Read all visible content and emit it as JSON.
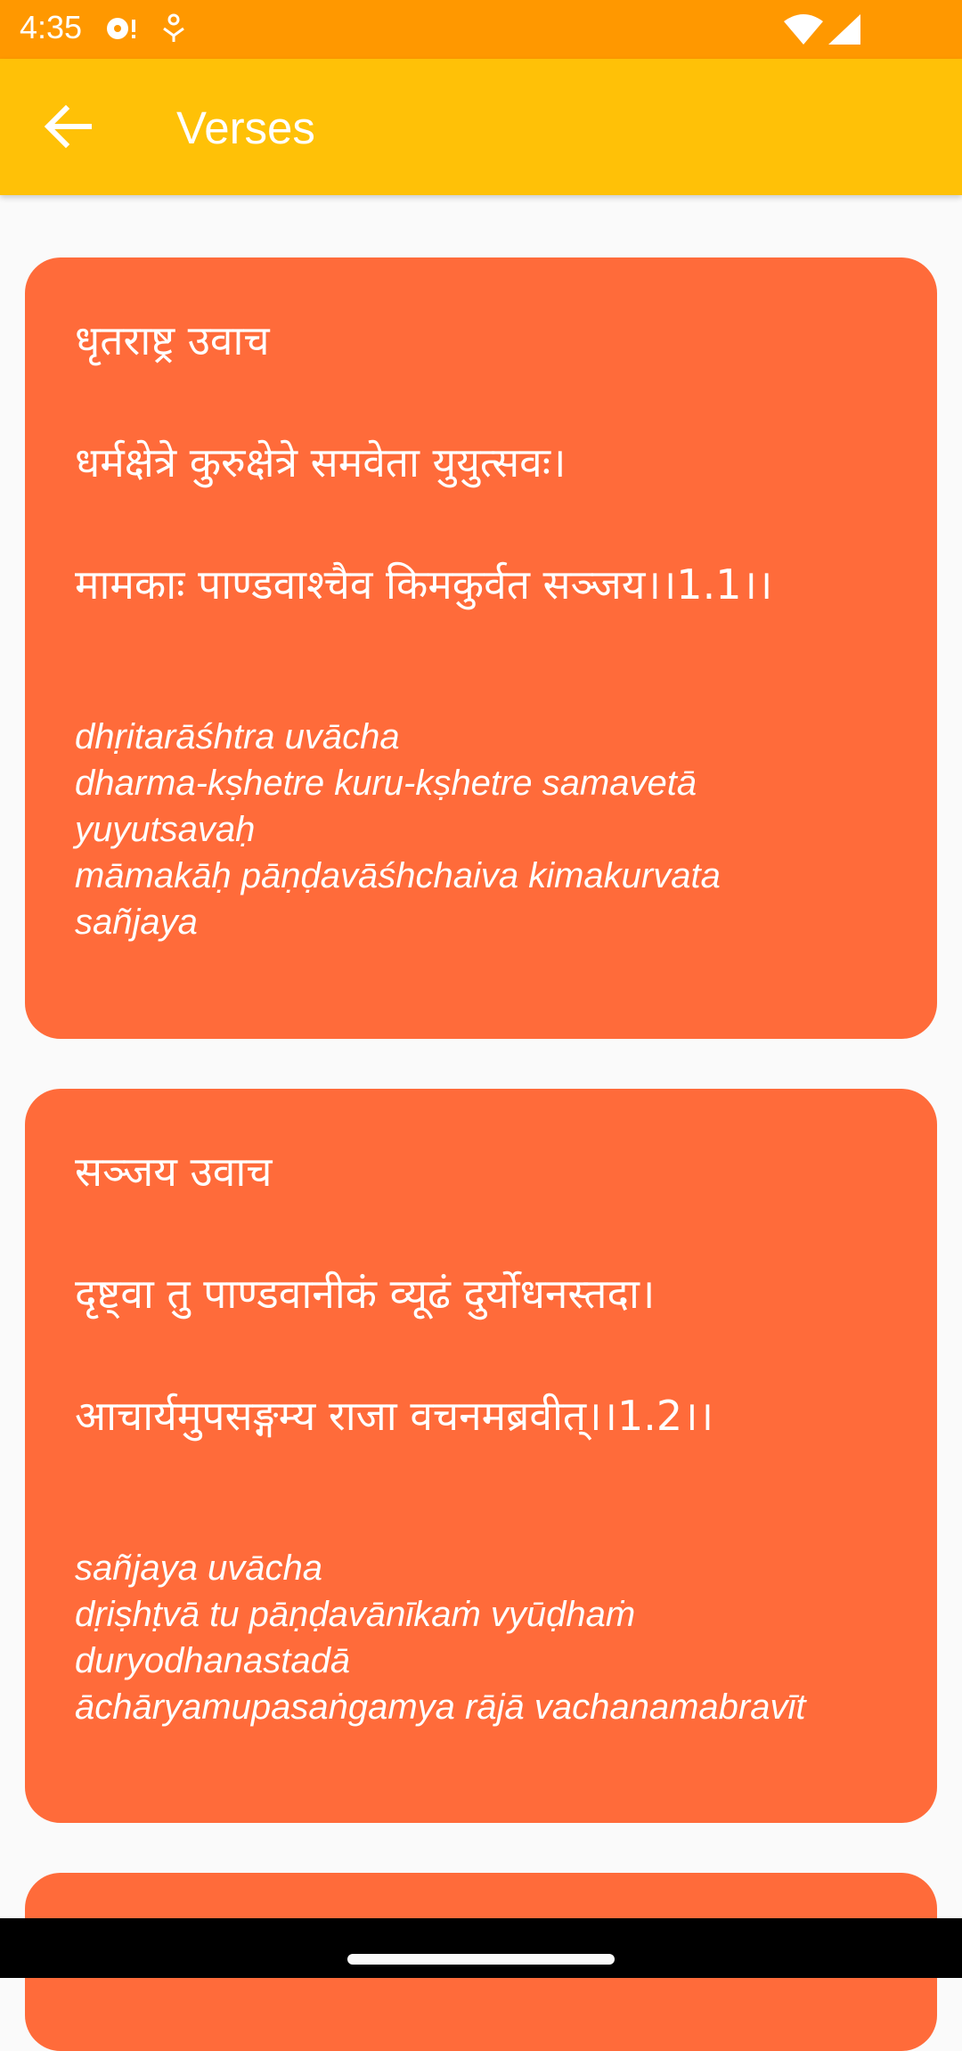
{
  "status_bar": {
    "time": "4:35",
    "icons": [
      "media-notification-icon",
      "notification-icon",
      "wifi-icon",
      "cellular-signal-icon"
    ]
  },
  "app_bar": {
    "title": "Verses",
    "back_icon": "arrow-left-icon"
  },
  "verses": [
    {
      "speaker": "धृतराष्ट्र उवाच",
      "line1": "धर्मक्षेत्रे कुरुक्षेत्रे समवेता युयुत्सवः।",
      "line2": "मामकाः पाण्डवाश्चैव किमकुर्वत सञ्जय।।1.1।।",
      "transliteration": [
        "dhṛitarāśhtra uvācha",
        "dharma-kṣhetre kuru-kṣhetre samavetā",
        "yuyutsavaḥ",
        "māmakāḥ pāṇḍavāśhchaiva kimakurvata",
        "sañjaya"
      ]
    },
    {
      "speaker": "सञ्जय उवाच",
      "line1": "दृष्ट्वा तु पाण्डवानीकं व्यूढं दुर्योधनस्तदा।",
      "line2": "आचार्यमुपसङ्गम्य राजा वचनमब्रवीत्।।1.2।।",
      "transliteration": [
        "sañjaya uvācha",
        "dṛiṣhṭvā tu pāṇḍavānīkaṁ vyūḍhaṁ",
        "duryodhanastadā",
        "āchāryamupasaṅgamya rājā vachanamabravīt"
      ]
    }
  ],
  "colors": {
    "status_bar": "#FF9800",
    "app_bar": "#FFC107",
    "card": "#FF6B3A",
    "text": "#FFFFFF"
  }
}
